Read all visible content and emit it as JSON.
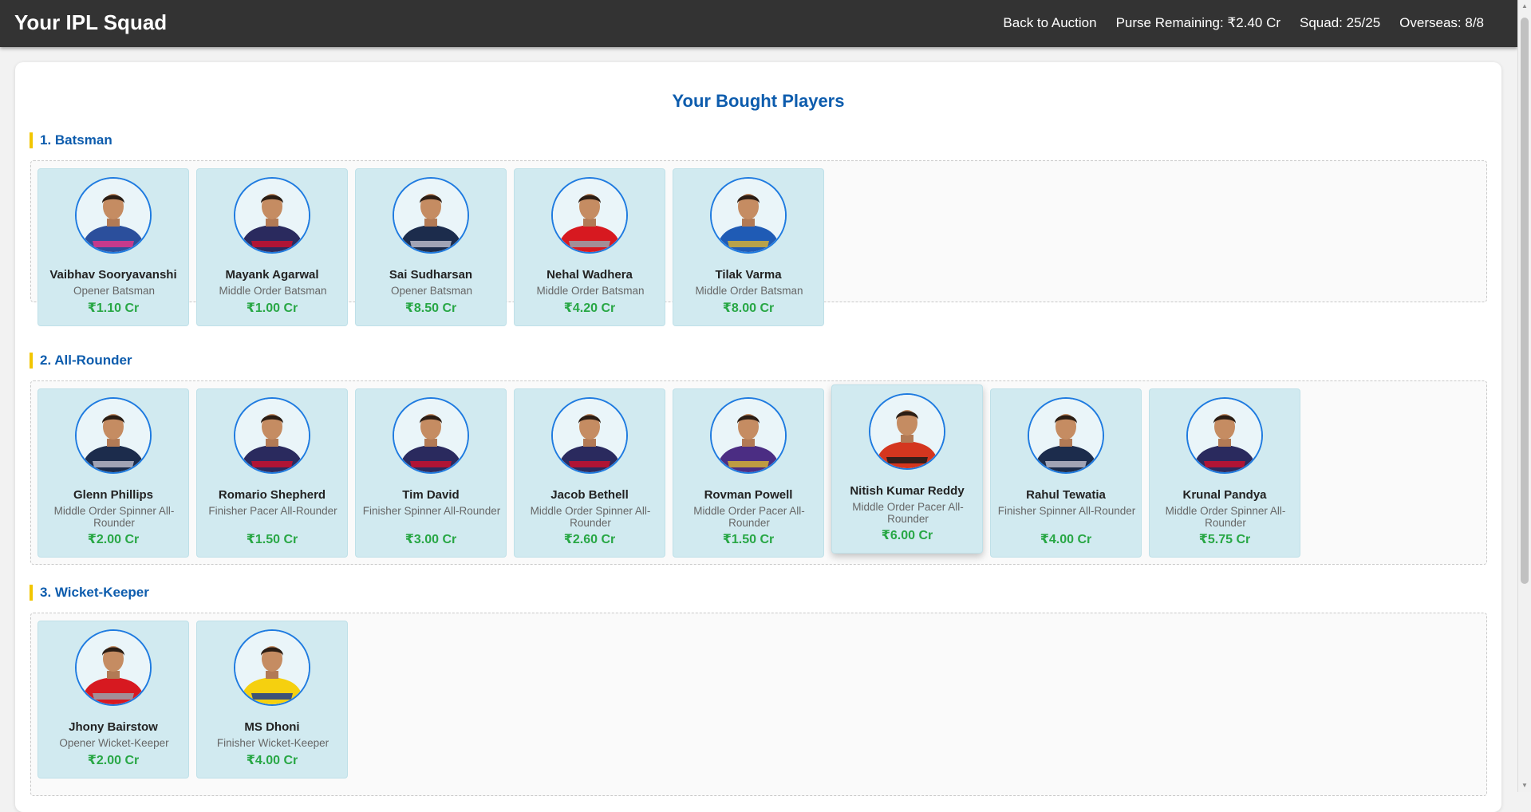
{
  "header": {
    "title": "Your IPL Squad",
    "back_link": "Back to Auction",
    "purse": "Purse Remaining: ₹2.40 Cr",
    "squad": "Squad: 25/25",
    "overseas": "Overseas: 8/8"
  },
  "main": {
    "heading": "Your Bought Players",
    "sections": [
      {
        "title": "1. Batsman",
        "players": [
          {
            "name": "Vaibhav Sooryavanshi",
            "role": "Opener Batsman",
            "price": "₹1.10 Cr",
            "jersey_color": "#2b4f9c",
            "accent_color": "#e0368a"
          },
          {
            "name": "Mayank Agarwal",
            "role": "Middle Order Batsman",
            "price": "₹1.00 Cr",
            "jersey_color": "#2a2a5e",
            "accent_color": "#c8102e"
          },
          {
            "name": "Sai Sudharsan",
            "role": "Opener Batsman",
            "price": "₹8.50 Cr",
            "jersey_color": "#1c2c4c",
            "accent_color": "#b8b8c8"
          },
          {
            "name": "Nehal Wadhera",
            "role": "Middle Order Batsman",
            "price": "₹4.20 Cr",
            "jersey_color": "#d71920",
            "accent_color": "#9aa3ad"
          },
          {
            "name": "Tilak Varma",
            "role": "Middle Order Batsman",
            "price": "₹8.00 Cr",
            "jersey_color": "#1f5bb5",
            "accent_color": "#d4af37"
          }
        ]
      },
      {
        "title": "2. All-Rounder",
        "players": [
          {
            "name": "Glenn Phillips",
            "role": "Middle Order Spinner All-Rounder",
            "price": "₹2.00 Cr",
            "jersey_color": "#1c2c4c",
            "accent_color": "#b8b8c8"
          },
          {
            "name": "Romario Shepherd",
            "role": "Finisher Pacer All-Rounder",
            "price": "₹1.50 Cr",
            "jersey_color": "#2a2a5e",
            "accent_color": "#c8102e"
          },
          {
            "name": "Tim David",
            "role": "Finisher Spinner All-Rounder",
            "price": "₹3.00 Cr",
            "jersey_color": "#2a2a5e",
            "accent_color": "#c8102e"
          },
          {
            "name": "Jacob Bethell",
            "role": "Middle Order Spinner All-Rounder",
            "price": "₹2.60 Cr",
            "jersey_color": "#2a2a5e",
            "accent_color": "#c8102e"
          },
          {
            "name": "Rovman Powell",
            "role": "Middle Order Pacer All-Rounder",
            "price": "₹1.50 Cr",
            "jersey_color": "#4b2d83",
            "accent_color": "#d4af37"
          },
          {
            "name": "Nitish Kumar Reddy",
            "role": "Middle Order Pacer All-Rounder",
            "price": "₹6.00 Cr",
            "jersey_color": "#d4361f",
            "accent_color": "#1a1a1a"
          },
          {
            "name": "Rahul Tewatia",
            "role": "Finisher Spinner All-Rounder",
            "price": "₹4.00 Cr",
            "jersey_color": "#1c2c4c",
            "accent_color": "#b8b8c8"
          },
          {
            "name": "Krunal Pandya",
            "role": "Middle Order Spinner All-Rounder",
            "price": "₹5.75 Cr",
            "jersey_color": "#2a2a5e",
            "accent_color": "#c8102e"
          }
        ]
      },
      {
        "title": "3. Wicket-Keeper",
        "players": [
          {
            "name": "Jhony Bairstow",
            "role": "Opener Wicket-Keeper",
            "price": "₹2.00 Cr",
            "jersey_color": "#d71920",
            "accent_color": "#9aa3ad"
          },
          {
            "name": "MS Dhoni",
            "role": "Finisher Wicket-Keeper",
            "price": "₹4.00 Cr",
            "jersey_color": "#f5d00f",
            "accent_color": "#1d3c8a"
          }
        ]
      }
    ]
  },
  "colors": {
    "header_bg": "#333333",
    "heading_blue": "#0d5cad",
    "section_accent": "#f2c600",
    "card_bg": "#d1eaf0",
    "avatar_border": "#1f7be0",
    "price_green": "#28a745"
  }
}
